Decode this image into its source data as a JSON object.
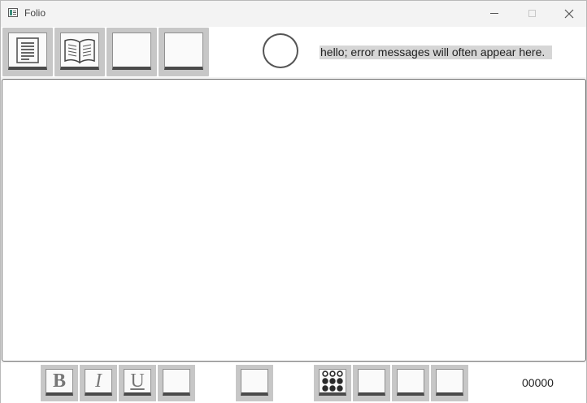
{
  "window": {
    "title": "Folio",
    "controls": {
      "minimize": "minimize-icon",
      "maximize": "maximize-icon",
      "close": "close-icon"
    }
  },
  "top_toolbar": {
    "buttons": [
      {
        "name": "document-button",
        "icon": "document-icon"
      },
      {
        "name": "open-book-button",
        "icon": "open-book-icon"
      },
      {
        "name": "blank-button-1",
        "icon": ""
      },
      {
        "name": "blank-button-2",
        "icon": ""
      }
    ],
    "status_indicator": "circle-icon",
    "message": "hello; error messages will often appear here."
  },
  "editor": {
    "content": ""
  },
  "bottom_toolbar": {
    "format": {
      "bold_label": "B",
      "italic_label": "I",
      "underline_label": "U"
    },
    "counter": "00000"
  },
  "colors": {
    "button_bg": "#c7c7c7",
    "button_face": "#fafafa",
    "button_shadow": "#4a4a4a",
    "message_bg": "#d6d6d6",
    "window_bg": "#f3f3f3"
  }
}
